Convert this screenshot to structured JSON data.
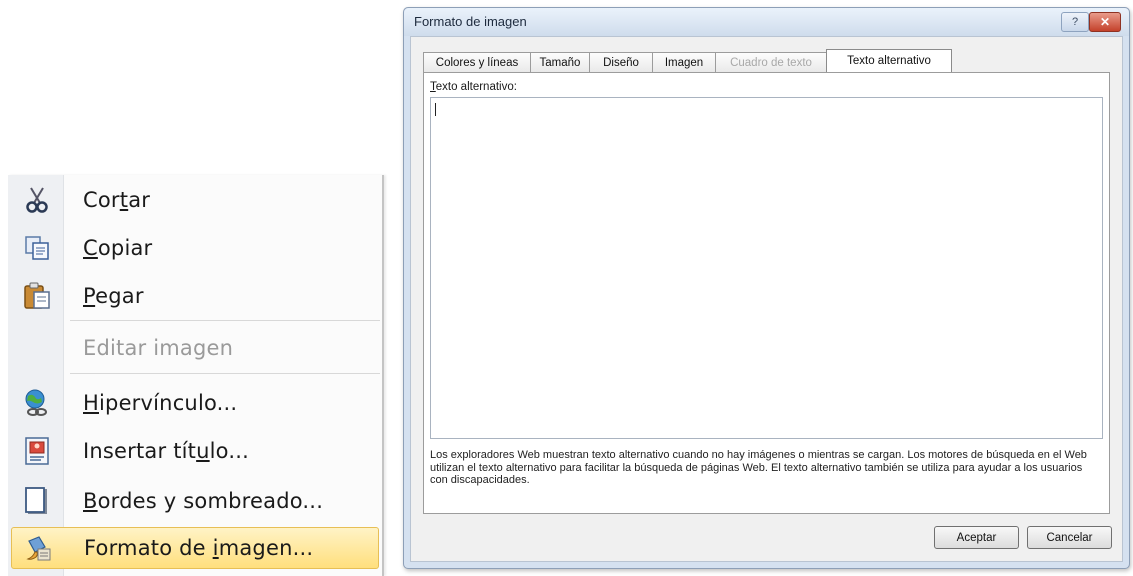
{
  "context_menu": {
    "items": [
      {
        "pre": "Cor",
        "ul": "t",
        "post": "ar",
        "icon": "scissors-icon",
        "disabled": false
      },
      {
        "pre": "",
        "ul": "C",
        "post": "opiar",
        "icon": "copy-icon",
        "disabled": false
      },
      {
        "pre": "",
        "ul": "P",
        "post": "egar",
        "icon": "paste-icon",
        "disabled": false
      },
      {
        "label": "Editar imagen",
        "disabled": true
      },
      {
        "pre": "",
        "ul": "H",
        "post": "ipervínculo...",
        "icon": "hyperlink-globe-icon",
        "disabled": false
      },
      {
        "pre": "Insertar tít",
        "ul": "u",
        "post": "lo...",
        "icon": "insert-caption-icon",
        "disabled": false
      },
      {
        "pre": "",
        "ul": "B",
        "post": "ordes y sombreado...",
        "icon": "borders-shading-icon",
        "disabled": false
      },
      {
        "pre": "Formato de ",
        "ul": "i",
        "post": "magen...",
        "icon": "format-picture-icon",
        "disabled": false,
        "highlighted": true
      }
    ]
  },
  "dialog": {
    "title": "Formato de imagen",
    "help_label": "?",
    "close_label": "✕",
    "tabs": [
      {
        "label": "Colores y líneas",
        "state": "normal"
      },
      {
        "label": "Tamaño",
        "state": "normal"
      },
      {
        "label": "Diseño",
        "state": "normal"
      },
      {
        "label": "Imagen",
        "state": "normal"
      },
      {
        "label": "Cuadro de texto",
        "state": "disabled"
      },
      {
        "label": "Texto alternativo",
        "state": "active"
      }
    ],
    "field_label_ul": "T",
    "field_label_rest": "exto alternativo:",
    "field_value": "",
    "hint": "Los exploradores Web muestran texto alternativo cuando no hay imágenes o mientras se cargan. Los motores de búsqueda en el Web utilizan el texto alternativo para facilitar la búsqueda de páginas Web. El texto alternativo también se utiliza para ayudar a los usuarios con discapacidades.",
    "accept_label": "Aceptar",
    "cancel_label": "Cancelar"
  },
  "colors": {
    "highlight_top": "#fff3c6",
    "highlight_bottom": "#ffdf7d",
    "close_button": "#c4422b",
    "dialog_frame": "#d5e1f0"
  }
}
